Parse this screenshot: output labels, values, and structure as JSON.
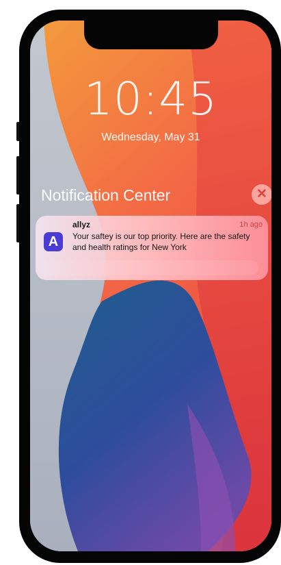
{
  "lock_screen": {
    "time": "10:45",
    "date": "Wednesday, May 31"
  },
  "notification_center": {
    "title": "Notification Center",
    "close_icon": "close-icon",
    "close_glyph": "✕"
  },
  "notification": {
    "app_name": "allyz",
    "app_icon": "allyz-app-icon",
    "app_icon_letter": "A",
    "time": "1h ago",
    "message": "Your saftey is our top priority. Here are the safety and health ratings for New York"
  },
  "colors": {
    "accent_close": "#e0433a",
    "app_icon_bg": "#4a3bd6"
  }
}
